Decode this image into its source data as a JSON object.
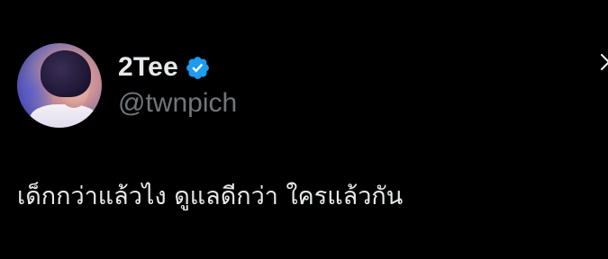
{
  "tweet": {
    "display_name": "2Tee",
    "handle": "@twnpich",
    "text": "เด็กกว่าแล้วไง ดูแลดีกว่า ใครแล้วกัน",
    "verified": true
  },
  "icons": {
    "verified": "verified-badge-icon",
    "more": "chevron-right-icon"
  },
  "colors": {
    "background": "#000000",
    "primary_text": "#e7e9ea",
    "secondary_text": "#71767b",
    "verified_blue": "#1d9bf0"
  }
}
